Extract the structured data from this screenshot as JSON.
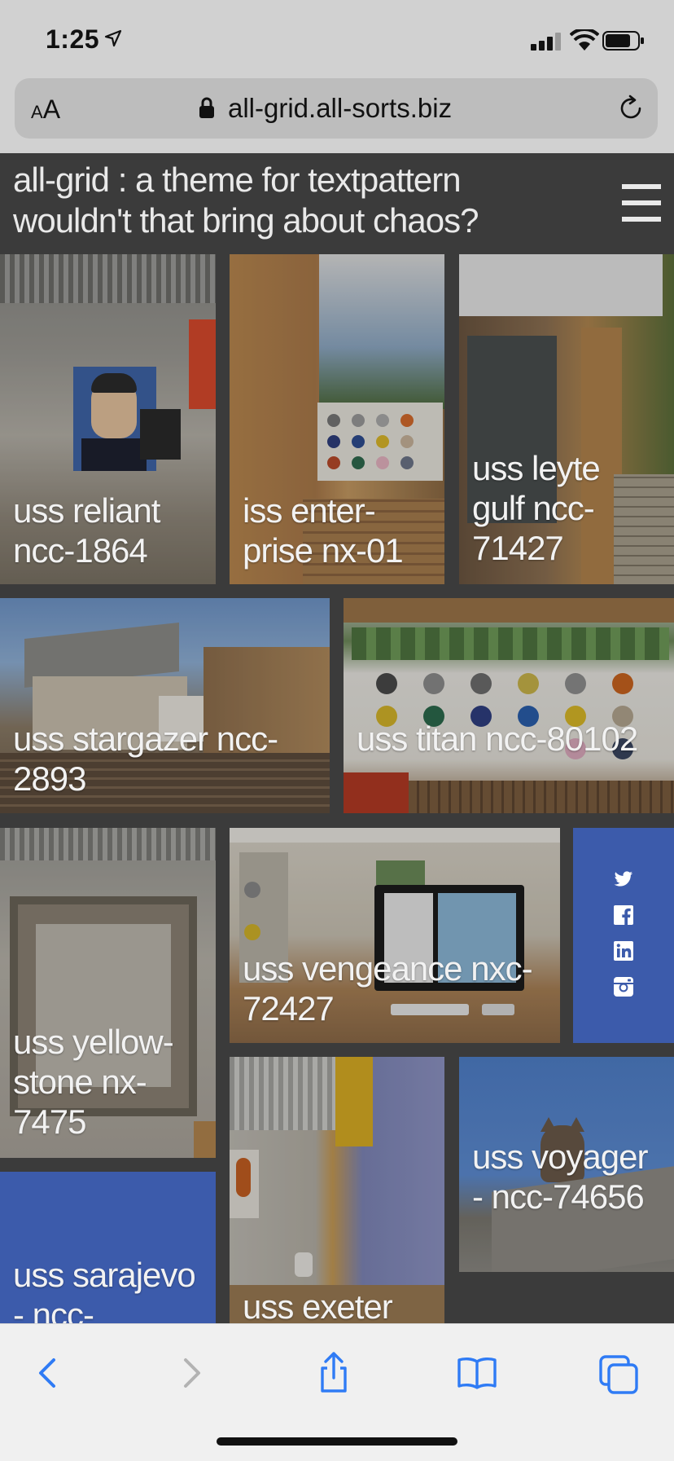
{
  "status_bar": {
    "time": "1:25",
    "icons": [
      "location-arrow-icon",
      "cellular-signal-icon",
      "wifi-icon",
      "battery-icon"
    ]
  },
  "url_bar": {
    "text_size_small": "A",
    "text_size_large": "A",
    "url": "all-grid.all-sorts.biz",
    "icons": [
      "lock-icon",
      "reload-icon"
    ]
  },
  "site_header": {
    "title": "all-grid : a theme for textpattern wouldn't that bring about chaos?",
    "menu_icon": "hamburger-menu-icon"
  },
  "tiles": [
    {
      "caption": "uss reliant ncc-1864"
    },
    {
      "caption": "iss enter-prise nx-01"
    },
    {
      "caption": "uss leyte gulf ncc-71427"
    },
    {
      "caption": "uss stargazer ncc-2893"
    },
    {
      "caption": "uss titan ncc-80102"
    },
    {
      "caption": "uss yellow-stone nx-7475"
    },
    {
      "caption": "uss vengeance nxc-72427"
    },
    {
      "caption": "uss voyager - ncc-74656"
    },
    {
      "caption": "uss sarajevo - ncc-"
    },
    {
      "caption": "uss exeter"
    }
  ],
  "social_icons": [
    "twitter-icon",
    "facebook-icon",
    "linkedin-icon",
    "instagram-icon"
  ],
  "toolbar": {
    "icons": [
      "back-icon",
      "forward-icon",
      "share-icon",
      "bookmarks-icon",
      "tabs-icon"
    ]
  },
  "colors": {
    "page_background": "#3b3b3b",
    "social_panel": "#3c5bab",
    "ios_accent": "#2f7bf5",
    "header_text": "#e9e9e9"
  }
}
